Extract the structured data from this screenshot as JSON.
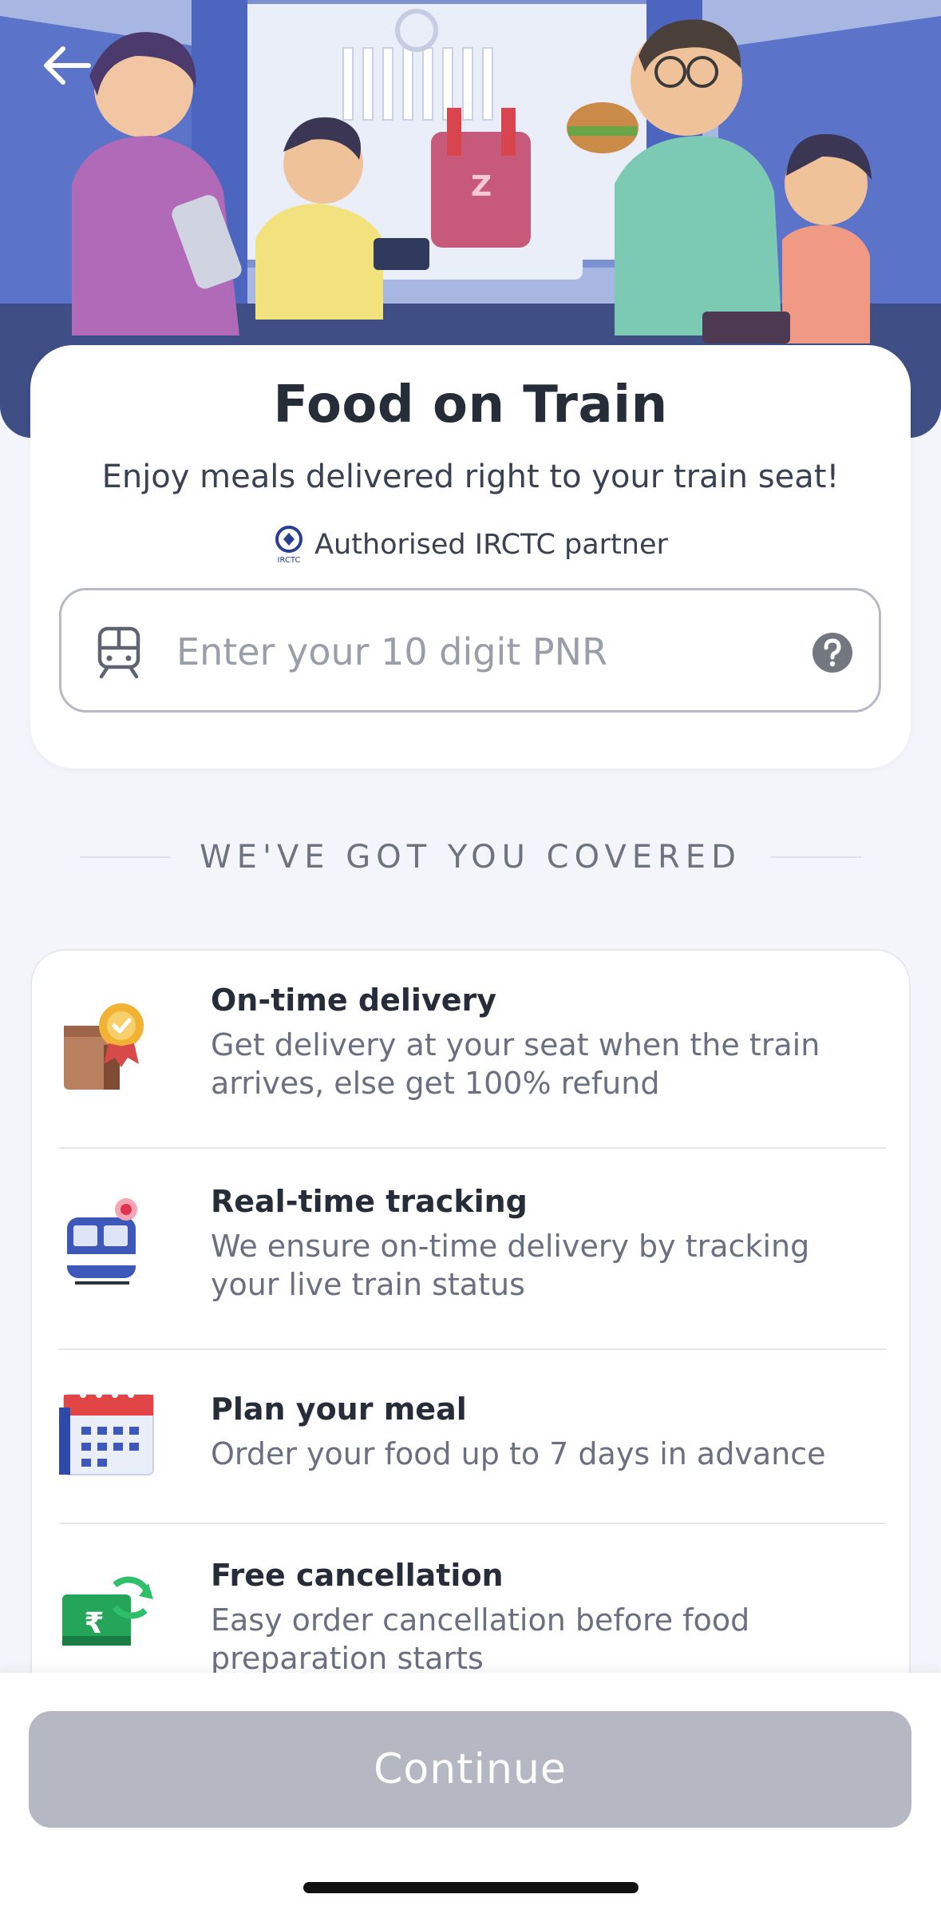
{
  "header": {
    "back_icon": "arrow-left-icon",
    "illustration": "family eating food on a train"
  },
  "main": {
    "title": "Food on Train",
    "subtitle": "Enjoy meals delivered right to your train seat!",
    "partner_text": "Authorised IRCTC partner",
    "partner_logo_text": "IRCTC",
    "pnr": {
      "value": "",
      "placeholder": "Enter your 10 digit PNR",
      "leading_icon": "train-icon",
      "trailing_icon": "help-icon"
    }
  },
  "section": {
    "heading": "WE'VE GOT YOU COVERED"
  },
  "features": [
    {
      "title": "On-time delivery",
      "description": "Get delivery at your seat when the train arrives, else get 100% refund",
      "icon": "delivery-bag-badge-icon"
    },
    {
      "title": "Real-time tracking",
      "description": "We ensure on-time delivery by tracking your live train status",
      "icon": "train-tracking-icon"
    },
    {
      "title": "Plan your meal",
      "description": "Order your food up to 7 days in advance",
      "icon": "calendar-icon"
    },
    {
      "title": "Free cancellation",
      "description": "Easy order cancellation before food preparation starts",
      "icon": "refund-cash-icon"
    }
  ],
  "footer": {
    "continue_label": "Continue"
  },
  "colors": {
    "button_disabled": "#b5b8c3",
    "background": "#f4f5fa",
    "title_text": "#262c38",
    "muted_text": "#6b7080"
  }
}
